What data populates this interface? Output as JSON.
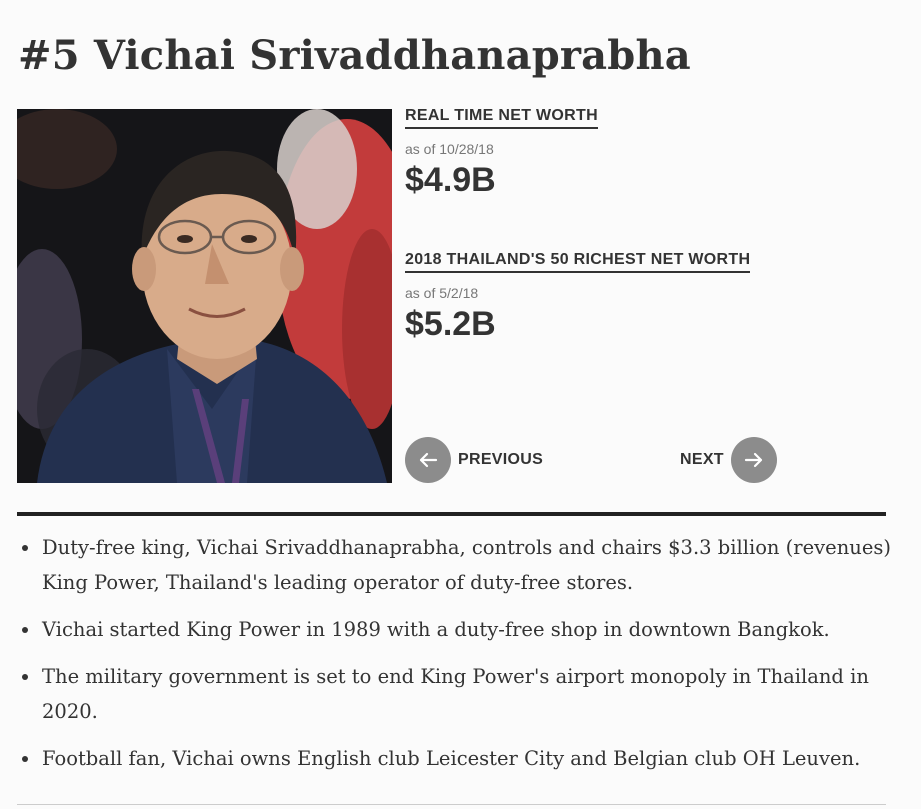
{
  "profile": {
    "title": "#5 Vichai Srivaddhanaprabha"
  },
  "net_worth": {
    "realtime_label": "REAL TIME NET WORTH",
    "realtime_date": "as of 10/28/18",
    "realtime_value": "$4.9B",
    "list_label": "2018 THAILAND'S 50 RICHEST NET WORTH",
    "list_date": "as of 5/2/18",
    "list_value": "$5.2B"
  },
  "nav": {
    "previous_label": "PREVIOUS",
    "next_label": "NEXT"
  },
  "bullets": [
    "Duty-free king, Vichai Srivaddhanaprabha, controls and chairs $3.3 billion (revenues) King Power, Thailand's leading operator of duty-free stores.",
    "Vichai started King Power in 1989 with a duty-free shop in downtown Bangkok.",
    "The military government is set to end King Power's airport monopoly in Thailand in 2020.",
    "Football fan, Vichai owns English club Leicester City and Belgian club OH Leuven."
  ],
  "colors": {
    "text": "#333333",
    "nav_circle": "#8c8c8c",
    "divider": "#222222"
  }
}
